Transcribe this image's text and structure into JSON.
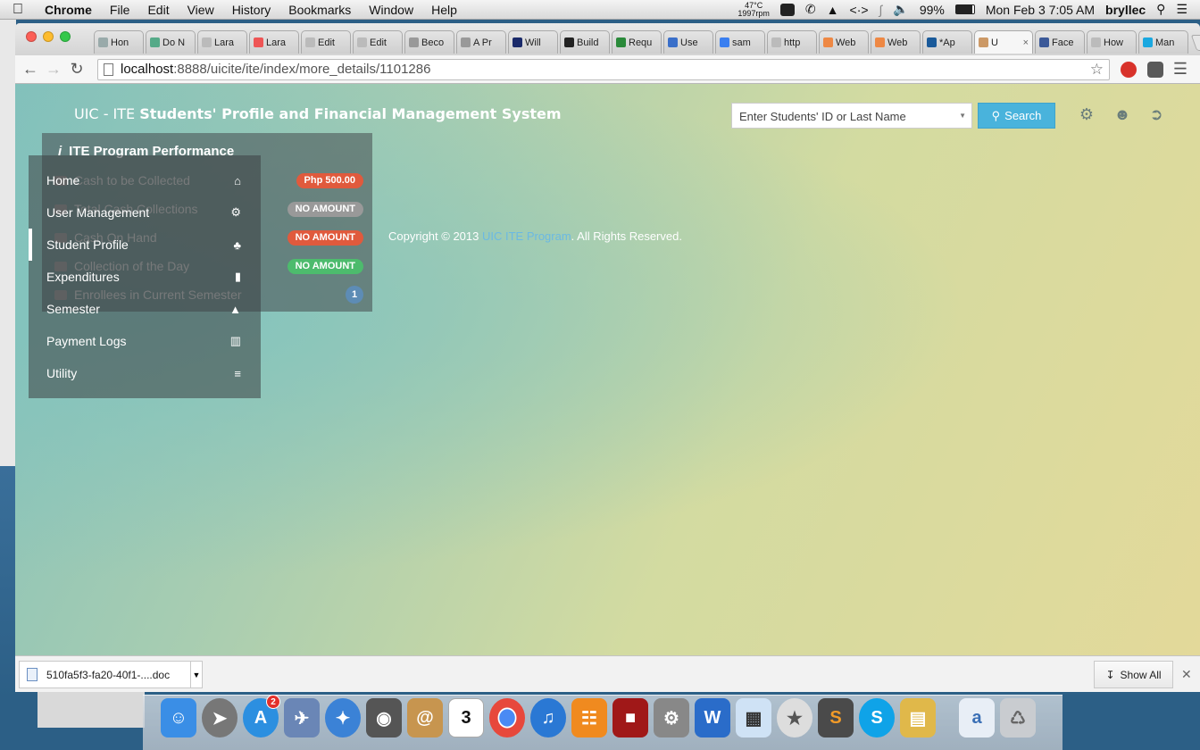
{
  "menubar": {
    "app_name": "Chrome",
    "items": [
      "File",
      "Edit",
      "View",
      "History",
      "Bookmarks",
      "Window",
      "Help"
    ],
    "temp": "47°C",
    "rpm": "1997rpm",
    "battery": "99%",
    "datetime": "Mon Feb 3  7:05 AM",
    "user": "bryllec"
  },
  "browser": {
    "tabs": [
      {
        "label": "Hon"
      },
      {
        "label": "Do N"
      },
      {
        "label": "Lara"
      },
      {
        "label": "Lara"
      },
      {
        "label": "Edit"
      },
      {
        "label": "Edit"
      },
      {
        "label": "Beco"
      },
      {
        "label": "A Pr"
      },
      {
        "label": "Will"
      },
      {
        "label": "Build"
      },
      {
        "label": "Requ"
      },
      {
        "label": "Use"
      },
      {
        "label": "sam"
      },
      {
        "label": "http"
      },
      {
        "label": "Web"
      },
      {
        "label": "Web"
      },
      {
        "label": "*Ap"
      },
      {
        "label": "U",
        "active": true
      },
      {
        "label": "Face"
      },
      {
        "label": "How"
      },
      {
        "label": "Man"
      }
    ],
    "url_host": "localhost",
    "url_path": ":8888/uicite/ite/index/more_details/1101286"
  },
  "app": {
    "title_prefix": "UIC - ITE ",
    "title_main": "Students' Profile and Financial Management System",
    "search_placeholder": "Enter Students' ID or Last Name",
    "search_button": "Search",
    "icons": [
      "gear-icon",
      "user-icon",
      "logout-icon"
    ]
  },
  "performance": {
    "title": "ITE Program Performance",
    "rows": [
      {
        "label": "Cash to be Collected",
        "badge": "Php 500.00",
        "color": "#e05a3d"
      },
      {
        "label": "Total Cash Collections",
        "badge": "NO AMOUNT",
        "color": "#999999"
      },
      {
        "label": "Cash On Hand",
        "badge": "NO AMOUNT",
        "color": "#e05a3d"
      },
      {
        "label": "Collection of the Day",
        "badge": "NO AMOUNT",
        "color": "#4dbb6d"
      },
      {
        "label": "Enrollees in Current Semester",
        "badge": "1",
        "color": "#5d8cb5"
      }
    ]
  },
  "sidenav": {
    "items": [
      {
        "label": "Home",
        "icon": "home-icon"
      },
      {
        "label": "User Management",
        "icon": "gears-icon"
      },
      {
        "label": "Student Profile",
        "icon": "shirt-icon",
        "active": true
      },
      {
        "label": "Expenditures",
        "icon": "book-icon"
      },
      {
        "label": "Semester",
        "icon": "graduation-cap-icon"
      },
      {
        "label": "Payment Logs",
        "icon": "map-icon"
      },
      {
        "label": "Utility",
        "icon": "database-icon"
      }
    ]
  },
  "footer": {
    "copyright_prefix": "Copyright © 2013 ",
    "link": "UIC ITE Program",
    "suffix": ". All Rights Reserved."
  },
  "downloads": {
    "file": "510fa5f3-fa20-40f1-....doc",
    "show_all": "Show All"
  },
  "dock": {
    "calendar_day": "3",
    "appstore_badge": "2"
  }
}
